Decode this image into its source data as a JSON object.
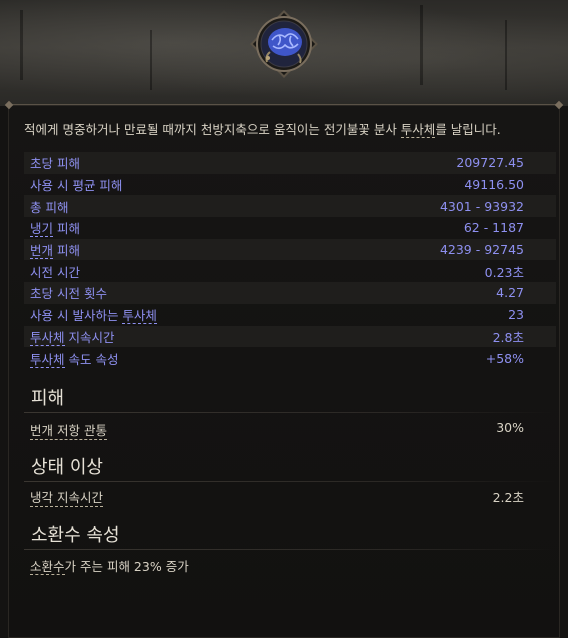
{
  "skill": {
    "icon": "blue-brain-orb-icon",
    "description_parts": [
      "적에게 명중하거나 만료될 때까지 천방지축으로 움직이는 전기불꽃 분사 ",
      "투사체",
      "를 날립니다."
    ]
  },
  "stats": [
    {
      "label": "초당 피해",
      "value": "209727.45"
    },
    {
      "label": "사용 시 평균 피해",
      "value": "49116.50"
    },
    {
      "label": "총 피해",
      "value": "4301 - 93932"
    },
    {
      "label_parts": [
        "냉기",
        " 피해"
      ],
      "value": "62 - 1187"
    },
    {
      "label_parts": [
        "번개",
        " 피해"
      ],
      "value": "4239 - 92745"
    },
    {
      "label": "시전 시간",
      "value": "0.23초"
    },
    {
      "label": "초당 시전 횟수",
      "value": "4.27"
    },
    {
      "label_parts": [
        "사용 시 발사하는 ",
        "투사체"
      ],
      "value": "23"
    },
    {
      "label_parts": [
        "투사체",
        " 지속시간"
      ],
      "value": "2.8초"
    },
    {
      "label_parts": [
        "투사체",
        " 속도 속성"
      ],
      "value": "+58%"
    }
  ],
  "sections": {
    "damage": {
      "title": "피해",
      "rows": [
        {
          "label": "번개 저항 관통",
          "value": "30%"
        }
      ]
    },
    "ailment": {
      "title": "상태 이상",
      "rows": [
        {
          "label": "냉각 지속시간",
          "value": "2.2초"
        }
      ]
    },
    "minion": {
      "title": "소환수 속성",
      "rows": [
        {
          "label_parts": [
            "소환수",
            "가 주는 피해 23% 증가"
          ],
          "value": ""
        }
      ]
    }
  },
  "colors": {
    "stat_text": "#8e90f0",
    "body_text": "#d8d2c4",
    "title_text": "#e6e1d6"
  }
}
